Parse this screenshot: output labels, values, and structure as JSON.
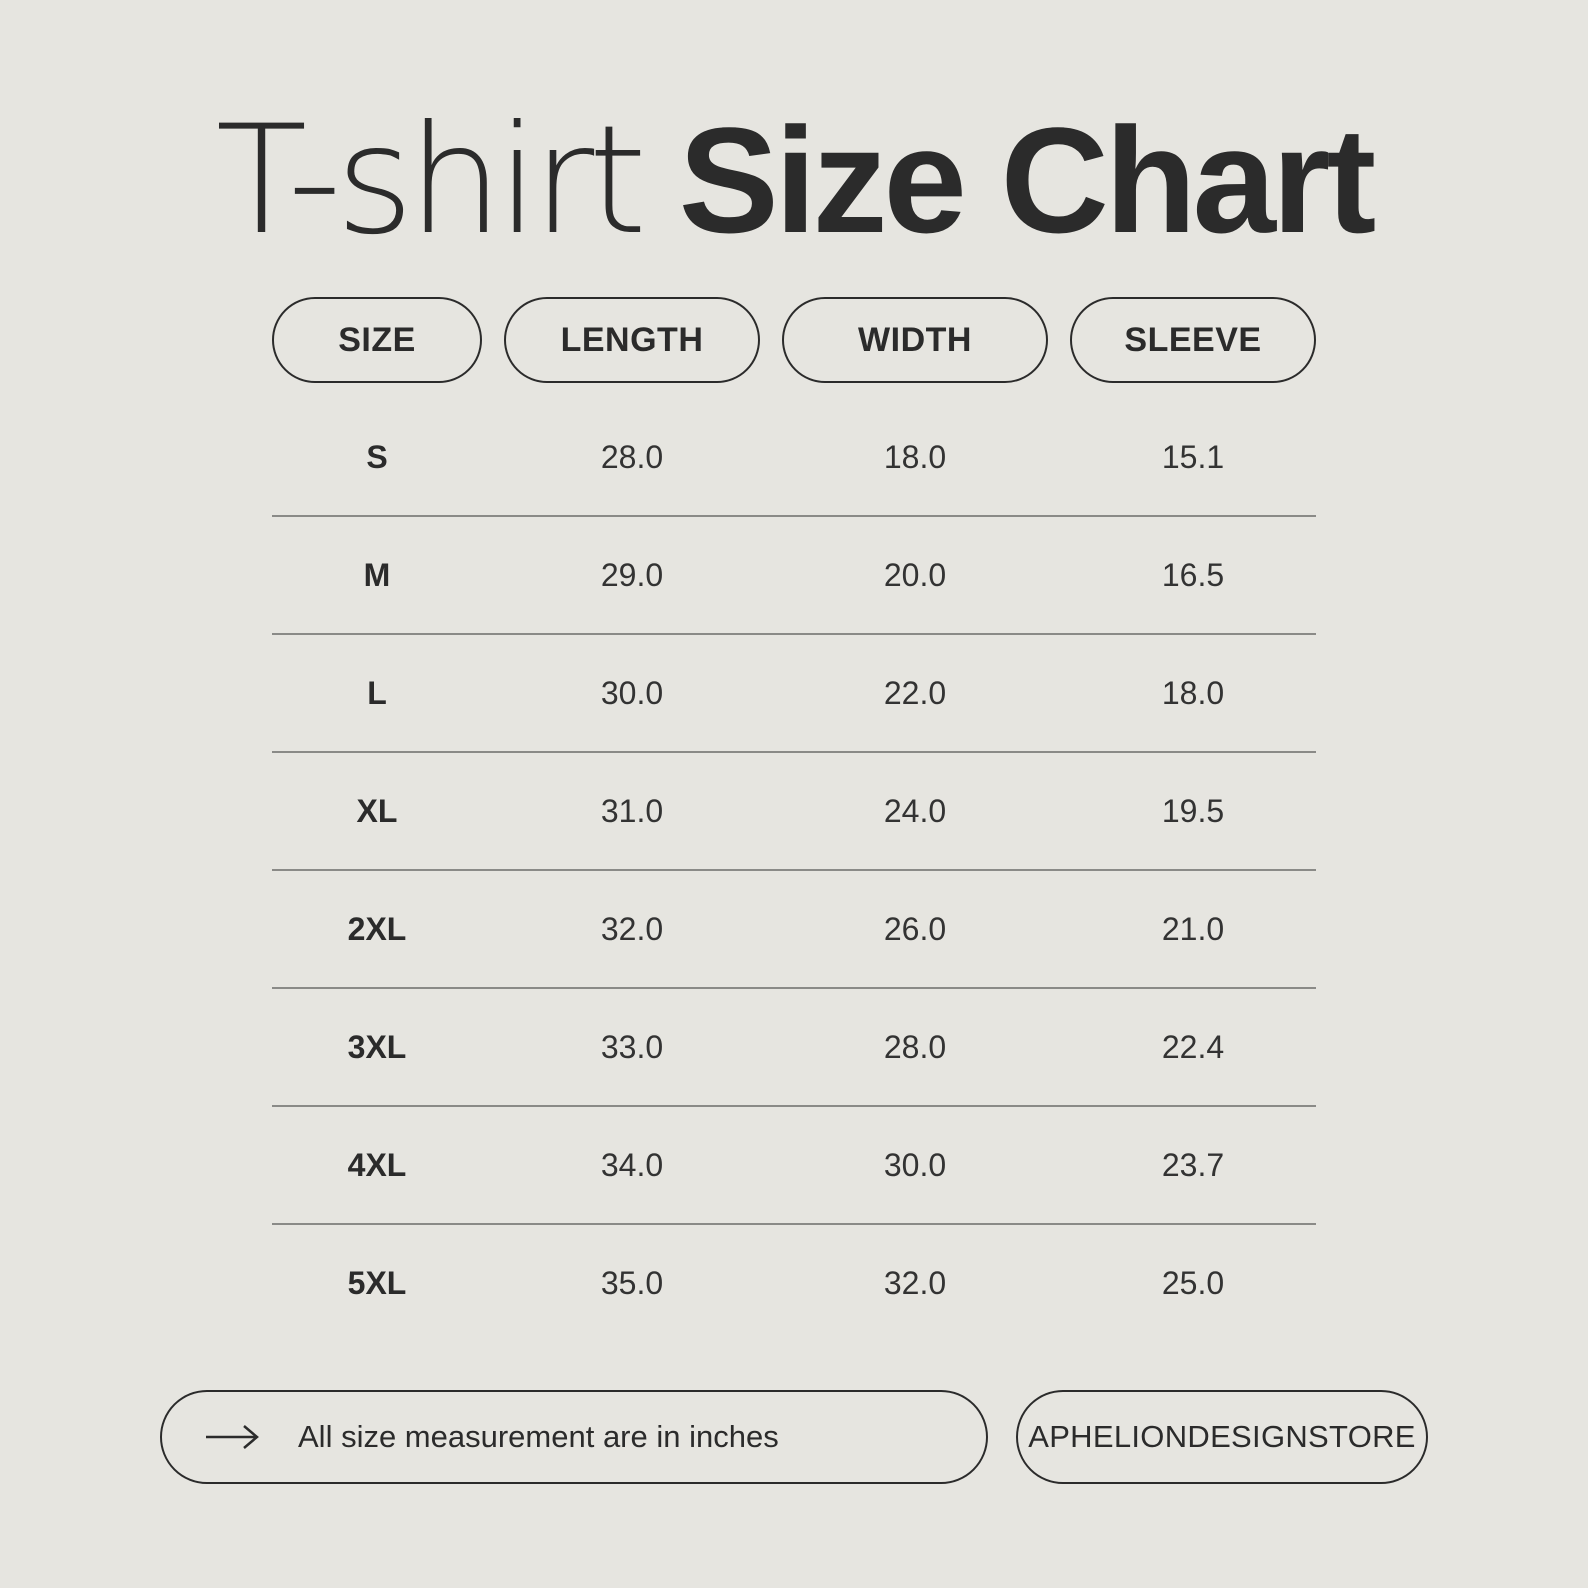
{
  "title": {
    "light": "T-shirt",
    "bold": "Size Chart"
  },
  "headers": [
    "SIZE",
    "LENGTH",
    "WIDTH",
    "SLEEVE"
  ],
  "rows": [
    [
      "S",
      "28.0",
      "18.0",
      "15.1"
    ],
    [
      "M",
      "29.0",
      "20.0",
      "16.5"
    ],
    [
      "L",
      "30.0",
      "22.0",
      "18.0"
    ],
    [
      "XL",
      "31.0",
      "24.0",
      "19.5"
    ],
    [
      "2XL",
      "32.0",
      "26.0",
      "21.0"
    ],
    [
      "3XL",
      "33.0",
      "28.0",
      "22.4"
    ],
    [
      "4XL",
      "34.0",
      "30.0",
      "23.7"
    ],
    [
      "5XL",
      "35.0",
      "32.0",
      "25.0"
    ]
  ],
  "footer": {
    "note_icon": "arrow-right-icon",
    "note": "All size measurement are in inches",
    "store": "APHELIONDESIGNSTORE"
  },
  "colors": {
    "background": "#e6e5e0",
    "ink": "#2b2b2b",
    "divider": "#8a8a87"
  }
}
